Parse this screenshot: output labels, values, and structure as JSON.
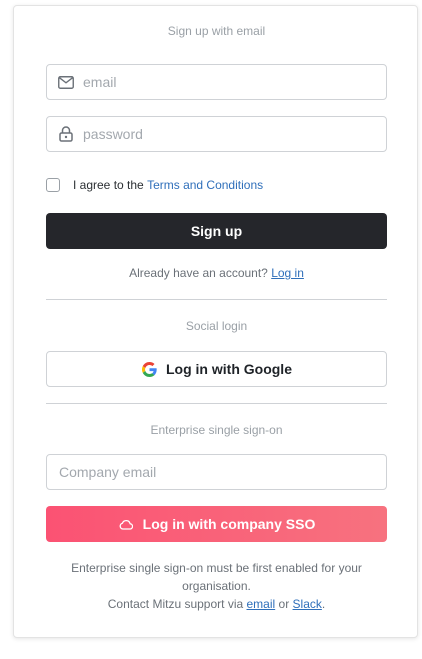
{
  "signup": {
    "heading": "Sign up with email",
    "email_placeholder": "email",
    "password_placeholder": "password",
    "agree_prefix": "I agree to the ",
    "terms_link": "Terms and Conditions",
    "button_label": "Sign up",
    "already_text": "Already have an account? ",
    "login_link": "Log in"
  },
  "social": {
    "heading": "Social login",
    "google_button": "Log in with Google"
  },
  "enterprise": {
    "heading": "Enterprise single sign-on",
    "company_email_placeholder": "Company email",
    "sso_button": "Log in with company SSO",
    "note_line1": "Enterprise single sign-on must be first enabled for your organisation.",
    "note_contact_prefix": "Contact Mitzu support via ",
    "email_link": "email",
    "note_or": " or ",
    "slack_link": "Slack",
    "note_period": "."
  },
  "icons": {
    "email": "mail-icon",
    "password": "lock-icon",
    "google": "google-icon",
    "sso": "cloud-icon"
  },
  "colors": {
    "dark_button": "#25262b",
    "sso_gradient_start": "#fb5273",
    "sso_gradient_end": "#f7727f",
    "link": "#2f6fba"
  }
}
